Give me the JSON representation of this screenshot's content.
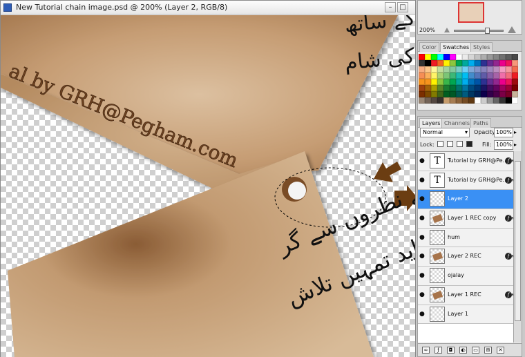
{
  "document": {
    "title": "New Tutorial chain image.psd @ 200% (Layer 2, RGB/8)",
    "minimize_glyph": "–",
    "maximize_glyph": "□"
  },
  "canvas_text": {
    "watermark": "al by GRH@Pegham.com",
    "urdu_line_1": "اُجالے اپنی یادوں کے ساتھ",
    "urdu_line_2": "نہ جانے کس گلی میں زندگی کی شام",
    "urdu_line_3": "ہم باوفا تھے اس لیئے نظروں سے گر",
    "urdu_line_4": "شاید تمہیں تلاش"
  },
  "navigator": {
    "zoom": "200%"
  },
  "swatches_panel": {
    "tabs": [
      "Color",
      "Swatches",
      "Styles"
    ],
    "active_tab": "Swatches",
    "colors": [
      "#ff0000",
      "#ffff00",
      "#00ff00",
      "#00ffff",
      "#0000ff",
      "#ff00ff",
      "#ffffff",
      "#ebebeb",
      "#d6d6d6",
      "#c2c2c2",
      "#adadad",
      "#999999",
      "#858585",
      "#707070",
      "#5c5c5c",
      "#474747",
      "#333333",
      "#000000",
      "#ee1c25",
      "#f26522",
      "#fff200",
      "#8dc63f",
      "#00a651",
      "#00a99d",
      "#00aeef",
      "#0072bc",
      "#2e3192",
      "#662d91",
      "#92278f",
      "#ec008c",
      "#ed145b",
      "#f7977a",
      "#f9ad81",
      "#fdc68a",
      "#fff79a",
      "#c4df9b",
      "#a3d39c",
      "#82ca9d",
      "#7bcdc8",
      "#6ecff6",
      "#7ea7d8",
      "#8493ca",
      "#8882be",
      "#a187be",
      "#bc8dbf",
      "#f49ac2",
      "#f6989d",
      "#f26c4f",
      "#f68e55",
      "#fbaf5c",
      "#fff467",
      "#acd372",
      "#7cc576",
      "#3bb878",
      "#1abbb4",
      "#00bff3",
      "#438ccb",
      "#5574b9",
      "#605ca8",
      "#855fa8",
      "#a763a8",
      "#f06ea9",
      "#f26d7d",
      "#ed1c24",
      "#f7941d",
      "#f7941d",
      "#fff200",
      "#8dc73f",
      "#39b54a",
      "#00a651",
      "#00a99d",
      "#00aeef",
      "#0072bc",
      "#0054a6",
      "#2e3192",
      "#662d91",
      "#92278f",
      "#ec008c",
      "#ed145a",
      "#9e0b0f",
      "#a0410d",
      "#a36209",
      "#aba000",
      "#598527",
      "#1a7b30",
      "#007236",
      "#00746b",
      "#0076a3",
      "#004a80",
      "#003471",
      "#1b1464",
      "#440e62",
      "#630460",
      "#9e005d",
      "#9e0039",
      "#790000",
      "#7b2e00",
      "#7d4900",
      "#827b00",
      "#406618",
      "#005e20",
      "#005826",
      "#005952",
      "#005b7f",
      "#003663",
      "#002157",
      "#0d004c",
      "#32004b",
      "#4b0049",
      "#7b0046",
      "#7a0026",
      "#c7b299",
      "#998675",
      "#736357",
      "#534741",
      "#37302d",
      "#c69c6d",
      "#a67c52",
      "#8c6239",
      "#754c24",
      "#603913",
      "#ffffff",
      "#cccccc",
      "#999999",
      "#666666",
      "#333333",
      "#000000",
      "#ffffff"
    ]
  },
  "layers_panel": {
    "tabs": [
      "Layers",
      "Channels",
      "Paths"
    ],
    "active_tab": "Layers",
    "blend_mode": "Normal",
    "opacity_label": "Opacity:",
    "opacity": "100%",
    "lock_label": "Lock:",
    "fill_label": "Fill:",
    "fill": "100%",
    "layers": [
      {
        "name": "Tutorial by GRH@Pe...",
        "thumb": "T",
        "type": "text",
        "fx": true,
        "selected": false
      },
      {
        "name": "Tutorial by GRH@Pe...",
        "thumb": "T",
        "type": "text",
        "fx": true,
        "selected": false
      },
      {
        "name": "Layer 2",
        "thumb": "",
        "type": "empty",
        "fx": false,
        "selected": true
      },
      {
        "name": "Layer 1 REC copy",
        "thumb": "",
        "type": "art",
        "fx": true,
        "selected": false
      },
      {
        "name": "hum",
        "thumb": "",
        "type": "empty",
        "fx": false,
        "selected": false
      },
      {
        "name": "Layer 2 REC",
        "thumb": "",
        "type": "art",
        "fx": true,
        "selected": false
      },
      {
        "name": "ojalay",
        "thumb": "",
        "type": "empty",
        "fx": false,
        "selected": false
      },
      {
        "name": "Layer 1 REC",
        "thumb": "",
        "type": "art",
        "fx": true,
        "selected": false
      },
      {
        "name": "Layer 1",
        "thumb": "",
        "type": "empty",
        "fx": false,
        "selected": false
      }
    ]
  },
  "colors": {
    "paper": "#c9a47f",
    "paper_dark": "#8f6440",
    "arrow": "#6b3d12",
    "selection_blue": "#3a90f4"
  }
}
